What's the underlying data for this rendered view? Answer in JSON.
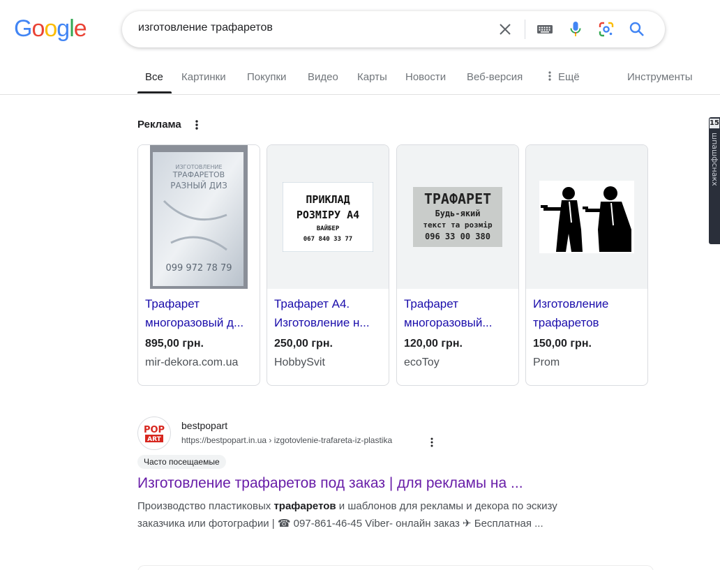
{
  "logo": {
    "letters": [
      {
        "ch": "G",
        "color": "#4285F4"
      },
      {
        "ch": "o",
        "color": "#EA4335"
      },
      {
        "ch": "o",
        "color": "#FBBC05"
      },
      {
        "ch": "g",
        "color": "#4285F4"
      },
      {
        "ch": "l",
        "color": "#34A853"
      },
      {
        "ch": "e",
        "color": "#EA4335"
      }
    ]
  },
  "search": {
    "value": "изготовление трафаретов",
    "icons": [
      "close-icon",
      "keyboard-icon",
      "microphone-icon",
      "google-lens-icon",
      "search-icon"
    ]
  },
  "tabs": {
    "all": "Все",
    "images": "Картинки",
    "shopping": "Покупки",
    "videos": "Видео",
    "maps": "Карты",
    "news": "Новости",
    "web": "Веб-версия",
    "more": "Ещё",
    "tools": "Инструменты"
  },
  "ads": {
    "label": "Реклама",
    "cards": [
      {
        "title1": "Трафарет",
        "title2": "многоразовый д...",
        "price": "895,00 грн.",
        "store": "mir-dekora.com.ua",
        "image_text": [
          "ИЗГОТОВЛЕНИЕ",
          "ТРАФАРЕТОВ",
          "РАЗНЫЙ ДИЗ",
          "099 972 78 79"
        ]
      },
      {
        "title1": "Трафарет А4.",
        "title2": "Изготовление н...",
        "price": "250,00 грн.",
        "store": "HobbySvit",
        "image_text": [
          "ПРИКЛАД",
          "РОЗМІРУ А4",
          "ВАЙБЕР",
          "067 840 33 77"
        ]
      },
      {
        "title1": "Трафарет",
        "title2": "многоразовый...",
        "price": "120,00 грн.",
        "store": "ecoToy",
        "image_text": [
          "ТРАФАРЕТ",
          "Будь-який",
          "текст та розмір",
          "096 33 00 380"
        ]
      },
      {
        "title1": "Изготовление",
        "title2": "трафаретов",
        "price": "150,00 грн.",
        "store": "Prom",
        "image_text": []
      }
    ]
  },
  "result": {
    "favicon_text": [
      "POP",
      "ART"
    ],
    "site_name": "bestpopart",
    "url": "https://bestpopart.in.ua › izgotovlenie-trafareta-iz-plastika",
    "badge": "Часто посещаемые",
    "title": "Изготовление трафаретов под заказ | для рекламы на ...",
    "snippet_1a": "Производство пластиковых ",
    "snippet_1b": "трафаретов",
    "snippet_1c": " и шаблонов для рекламы и декора по эскизу",
    "snippet_2": "заказчика или фотографии | ☎ 097-861-46-45 Viber- онлайн заказ ✈ Бесплатная ..."
  },
  "side_widget": {
    "number": "15",
    "text": "шпашфснакх"
  }
}
